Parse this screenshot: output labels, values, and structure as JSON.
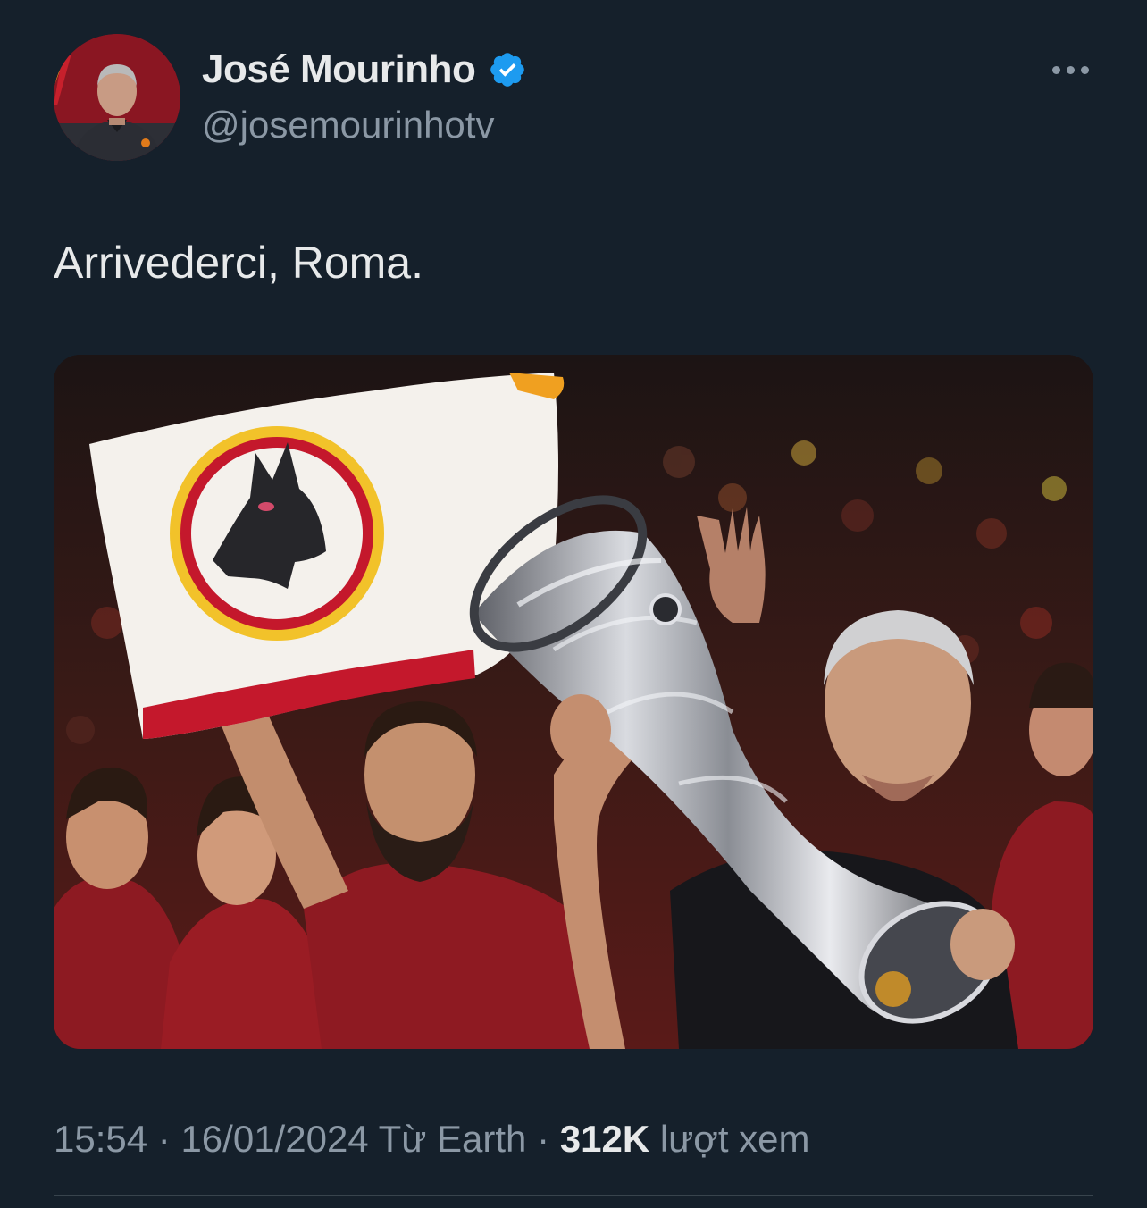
{
  "author": {
    "display_name": "José Mourinho",
    "handle": "@josemourinhotv",
    "verified": true
  },
  "more_icon": "more-horizontal-icon",
  "tweet": {
    "text": "Arrivederci, Roma."
  },
  "media": {
    "type": "photo"
  },
  "meta": {
    "time": "15:54",
    "separator": "·",
    "date": "16/01/2024",
    "source": "Từ Earth",
    "views_count": "312K",
    "views_label": "lượt xem"
  },
  "colors": {
    "background": "#15202b",
    "primary_text": "#e7e9ea",
    "secondary_text": "#8b98a5",
    "verified_blue": "#1d9bf0",
    "divider": "#38444d"
  }
}
